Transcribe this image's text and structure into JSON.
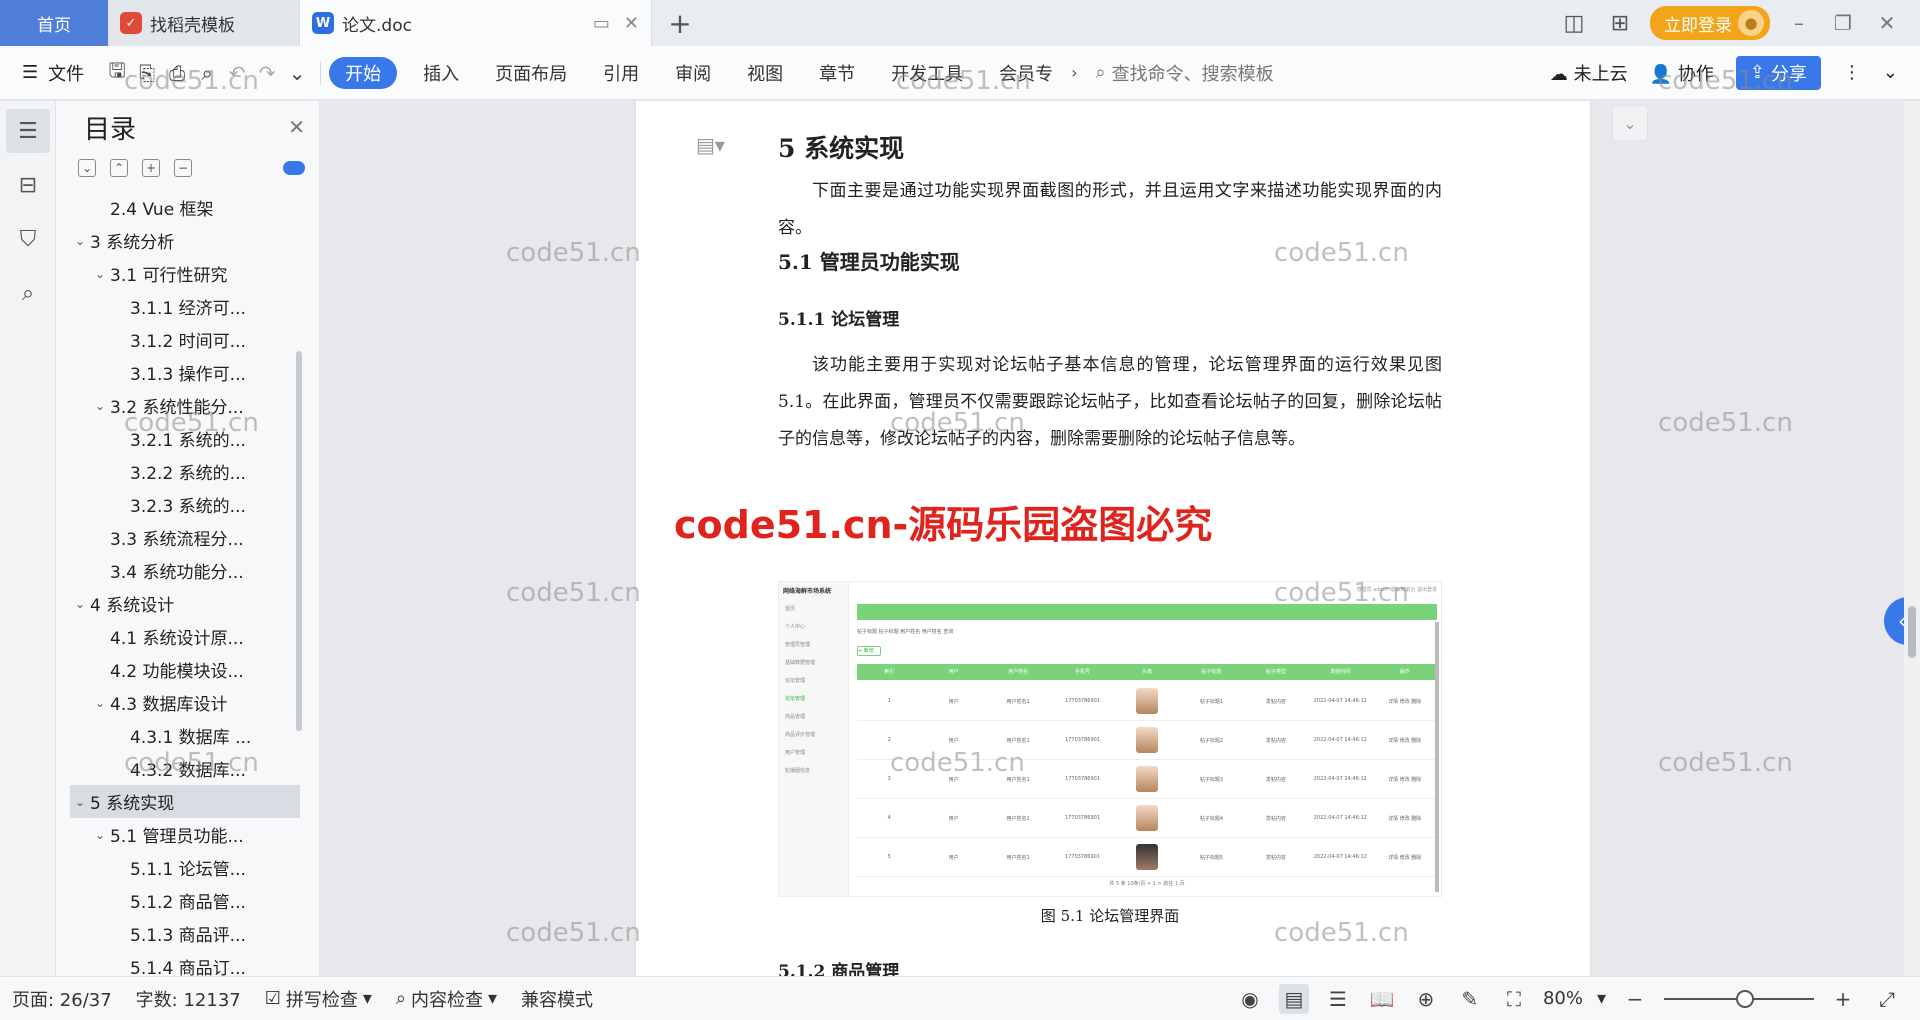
{
  "titlebar": {
    "home_tab": "首页",
    "tabs": [
      {
        "label": "找稻壳模板",
        "icon": "daoke-icon"
      },
      {
        "label": "论文.doc",
        "icon": "word-doc-icon"
      }
    ],
    "new_tab": "+",
    "login_label": "立即登录"
  },
  "ribbon": {
    "file_label": "文件",
    "menu": [
      "开始",
      "插入",
      "页面布局",
      "引用",
      "审阅",
      "视图",
      "章节",
      "开发工具",
      "会员专"
    ],
    "search_placeholder": "查找命令、搜索模板",
    "cloud_label": "未上云",
    "collab_label": "协作",
    "share_label": "分享"
  },
  "toc": {
    "title": "目录",
    "items": [
      {
        "label": "2.4  Vue 框架",
        "level": 2,
        "caret": ""
      },
      {
        "label": "3  系统分析",
        "level": 1,
        "caret": "⌄"
      },
      {
        "label": "3.1  可行性研究",
        "level": 2,
        "caret": "⌄"
      },
      {
        "label": "3.1.1  经济可...",
        "level": 3,
        "caret": ""
      },
      {
        "label": "3.1.2  时间可...",
        "level": 3,
        "caret": ""
      },
      {
        "label": "3.1.3  操作可...",
        "level": 3,
        "caret": ""
      },
      {
        "label": "3.2  系统性能分...",
        "level": 2,
        "caret": "⌄"
      },
      {
        "label": "3.2.1  系统的...",
        "level": 3,
        "caret": ""
      },
      {
        "label": "3.2.2  系统的...",
        "level": 3,
        "caret": ""
      },
      {
        "label": "3.2.3  系统的...",
        "level": 3,
        "caret": ""
      },
      {
        "label": "3.3  系统流程分...",
        "level": 2,
        "caret": ""
      },
      {
        "label": "3.4  系统功能分...",
        "level": 2,
        "caret": ""
      },
      {
        "label": "4  系统设计",
        "level": 1,
        "caret": "⌄"
      },
      {
        "label": "4.1  系统设计原...",
        "level": 2,
        "caret": ""
      },
      {
        "label": "4.2  功能模块设...",
        "level": 2,
        "caret": ""
      },
      {
        "label": "4.3  数据库设计",
        "level": 2,
        "caret": "⌄"
      },
      {
        "label": "4.3.1  数据库 ...",
        "level": 3,
        "caret": ""
      },
      {
        "label": "4.3.2  数据库...",
        "level": 3,
        "caret": ""
      },
      {
        "label": "5  系统实现",
        "level": 1,
        "caret": "⌄",
        "selected": true
      },
      {
        "label": "5.1  管理员功能...",
        "level": 2,
        "caret": "⌄"
      },
      {
        "label": "5.1.1  论坛管...",
        "level": 3,
        "caret": ""
      },
      {
        "label": "5.1.2  商品管...",
        "level": 3,
        "caret": ""
      },
      {
        "label": "5.1.3  商品评...",
        "level": 3,
        "caret": ""
      },
      {
        "label": "5.1.4  商品订...",
        "level": 3,
        "caret": ""
      }
    ]
  },
  "document": {
    "h1": "5  系统实现",
    "intro": "下面主要是通过功能实现界面截图的形式，并且运用文字来描述功能实现界面的内容。",
    "h2": "5.1  管理员功能实现",
    "h3": "5.1.1  论坛管理",
    "para": "该功能主要用于实现对论坛帖子基本信息的管理，论坛管理界面的运行效果见图 5.1。在此界面，管理员不仅需要跟踪论坛帖子，比如查看论坛帖子的回复，删除论坛帖子的信息等，修改论坛帖子的内容，删除需要删除的论坛帖子信息等。",
    "caption": "图 5.1  论坛管理界面",
    "next_h3": "5.1.2  商品管理",
    "figure": {
      "app_title": "网络海鲜市场系统",
      "top_right": "管理员 admin   退出到前台   退出登录",
      "side_items": [
        "首页",
        "个人中心",
        "管理员管理",
        "基础数据管理",
        "论坛管理",
        "论坛管理",
        "商品管理",
        "商品评价管理",
        "用户管理",
        "轮播图信息"
      ],
      "filter_text": "帖子标题  帖子标题     用户姓名  用户姓名     查询",
      "add_label": "+ 新增",
      "columns": [
        "索引",
        "用户",
        "用户姓名",
        "手机号",
        "头像",
        "帖子标题",
        "帖子类型",
        "发帖时间",
        "操作"
      ],
      "rows": [
        [
          "1",
          "用户",
          "用户姓名1",
          "17703786901",
          "",
          "帖子标题1",
          "发帖内容",
          "2022-04-07 14:46:12",
          "详情 修改 删除"
        ],
        [
          "2",
          "用户",
          "用户姓名1",
          "17703786901",
          "",
          "帖子标题2",
          "发帖内容",
          "2022-04-07 14:46:12",
          "详情 修改 删除"
        ],
        [
          "3",
          "用户",
          "用户姓名1",
          "17703786901",
          "",
          "帖子标题3",
          "发帖内容",
          "2022-04-07 14:46:12",
          "详情 修改 删除"
        ],
        [
          "4",
          "用户",
          "用户姓名1",
          "17703786901",
          "",
          "帖子标题4",
          "发帖内容",
          "2022-04-07 14:46:12",
          "详情 修改 删除"
        ],
        [
          "5",
          "用户",
          "用户姓名1",
          "17703786901",
          "",
          "帖子标题5",
          "发帖内容",
          "2022-04-07 14:46:12",
          "详情 修改 删除"
        ]
      ],
      "pager": "共 5 条   10条/页   <  1  >   前往  1  页"
    }
  },
  "watermark": {
    "text": "code51.cn",
    "red_text": "code51.cn-源码乐园盗图必究"
  },
  "status": {
    "page": "页面: 26/37",
    "words": "字数: 12137",
    "spell": "拼写检查",
    "content_check": "内容检查",
    "compat": "兼容模式",
    "zoom": "80%"
  },
  "colors": {
    "accent": "#3978e8",
    "home_tab": "#4f7fd8",
    "login": "#f2a51a",
    "watermark_red": "#e0231c"
  }
}
